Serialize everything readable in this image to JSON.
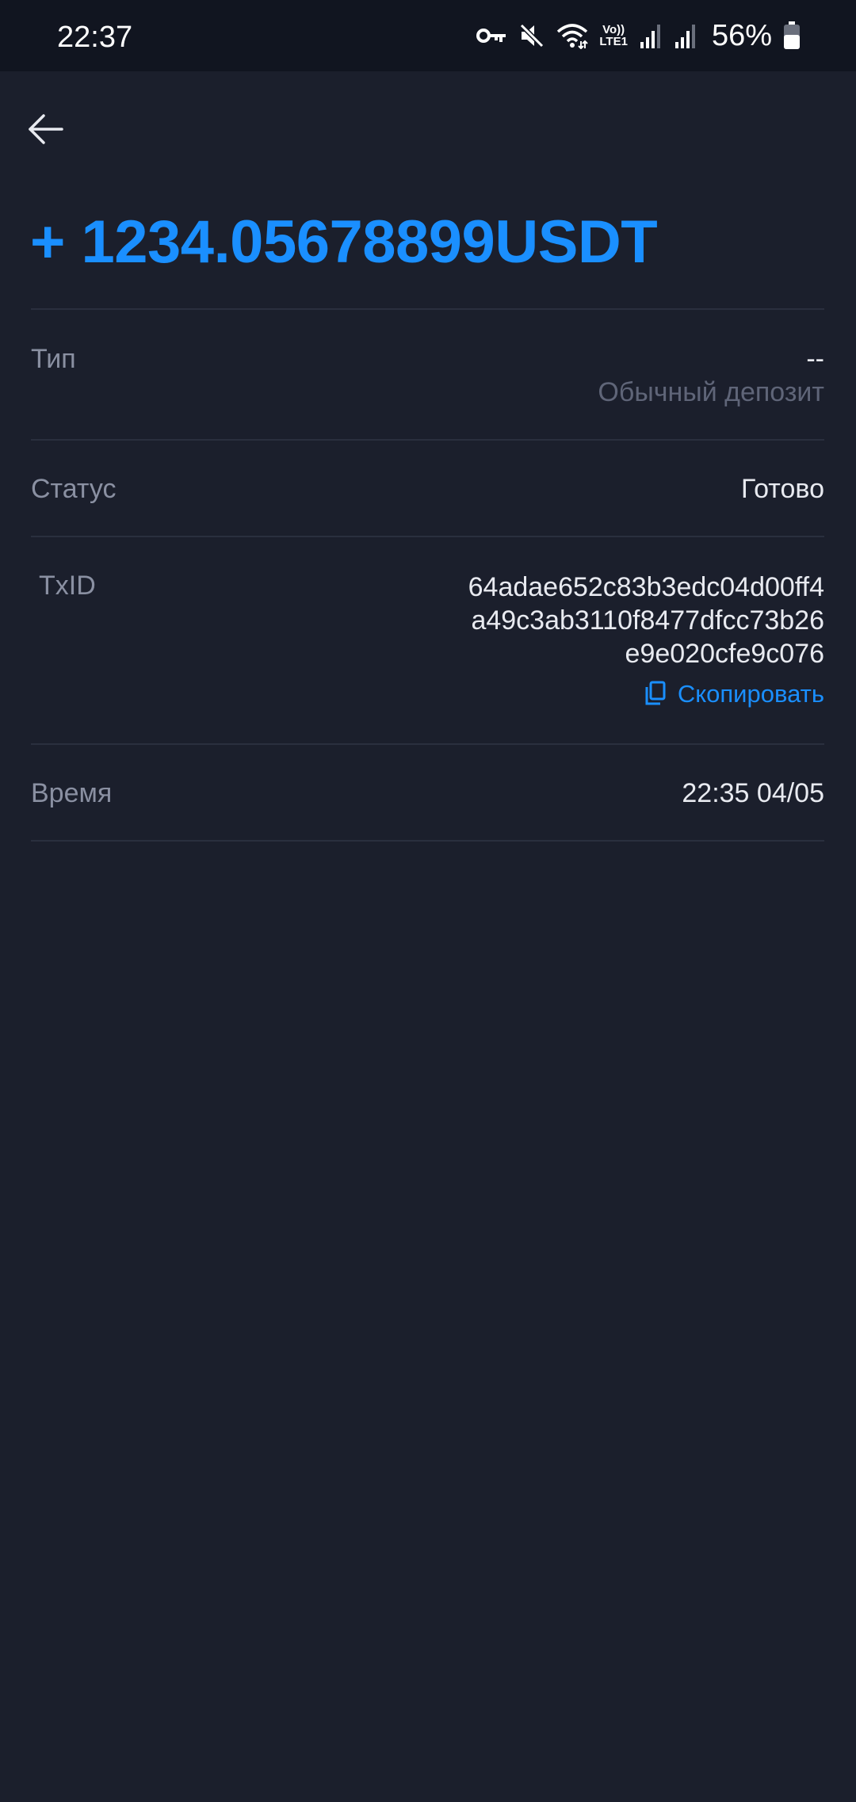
{
  "status_bar": {
    "time": "22:37",
    "battery_percent": "56%",
    "icons": [
      "vpn-key-icon",
      "mute-icon",
      "wifi-icon",
      "volte-lte1-icon",
      "signal-icon",
      "signal-icon",
      "battery-icon"
    ],
    "volte_top": "Vo))",
    "volte_bottom": "LTE1"
  },
  "header": {
    "back_icon": "arrow-left-icon"
  },
  "amount": "+ 1234.05678899USDT",
  "details": {
    "type_label": "Тип",
    "type_value": "--",
    "type_sub": "Обычный депозит",
    "status_label": "Статус",
    "status_value": "Готово",
    "txid_label": "TxID",
    "txid_lines": [
      "64adae652c83b3edc04d00ff4",
      "a49c3ab3110f8477dfcc73b26",
      "e9e020cfe9c076"
    ],
    "copy_label": "Скопировать",
    "copy_icon": "copy-icon",
    "time_label": "Время",
    "time_value": "22:35 04/05"
  },
  "colors": {
    "background": "#1b1f2c",
    "status_bar": "#111520",
    "accent": "#1a8fff",
    "label": "#8a90a2",
    "value": "#e8eaf0",
    "divider": "#2a2f3e"
  }
}
